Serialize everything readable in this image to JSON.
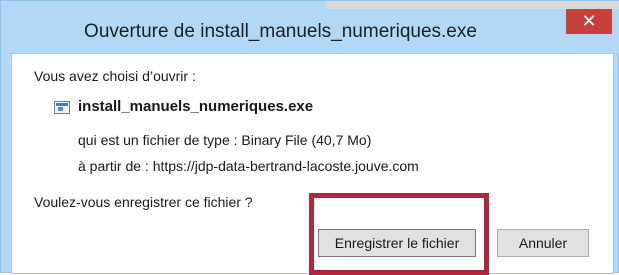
{
  "dialog": {
    "title": "Ouverture de install_manuels_numeriques.exe",
    "close_label": "✕",
    "intro_text": "Vous avez choisi d’ouvrir :",
    "file_icon": "executable-file-icon",
    "file_name": "install_manuels_numeriques.exe",
    "file_type_text": "qui est un fichier de type : Binary File (40,7 Mo)",
    "source_text": "à partir de : https://jdp-data-bertrand-lacoste.jouve.com",
    "question_text": "Voulez-vous enregistrer ce fichier ?",
    "save_label": "Enregistrer le fichier",
    "cancel_label": "Annuler"
  },
  "colors": {
    "title_bar": "#b3d8f5",
    "close_button": "#c7413a",
    "highlight_box": "#b1263f"
  }
}
